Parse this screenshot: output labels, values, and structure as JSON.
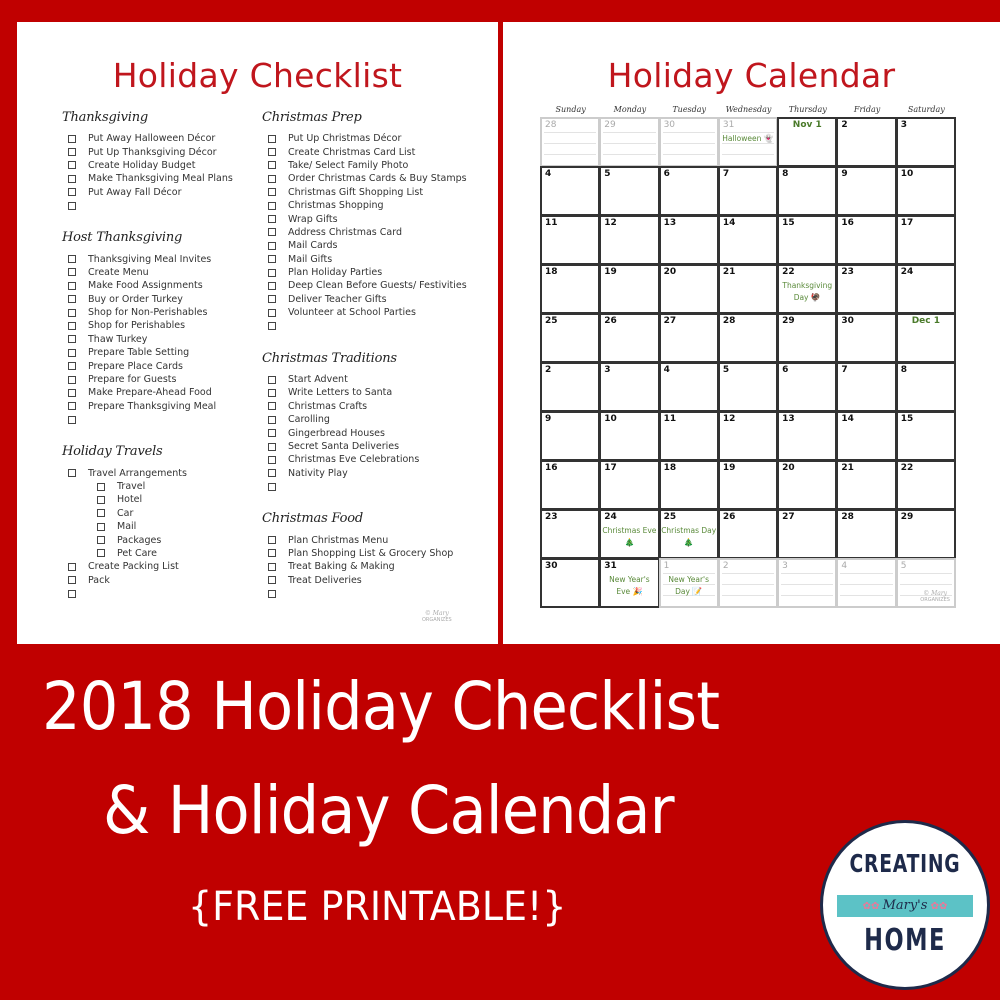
{
  "colors": {
    "background": "#c00000",
    "title_red": "#c0161d",
    "holiday_green": "#5a8a3a",
    "logo_navy": "#1e2a4a",
    "logo_teal": "#5cc2c6"
  },
  "checklist": {
    "title": "Holiday Checklist",
    "column1": [
      {
        "title": "Thanksgiving",
        "items": [
          {
            "label": "Put Away Halloween Décor"
          },
          {
            "label": "Put Up Thanksgiving Décor"
          },
          {
            "label": "Create Holiday Budget"
          },
          {
            "label": "Make Thanksgiving Meal Plans"
          },
          {
            "label": "Put Away Fall Décor"
          },
          {
            "label": ""
          }
        ]
      },
      {
        "title": "Host Thanksgiving",
        "items": [
          {
            "label": "Thanksgiving Meal Invites"
          },
          {
            "label": "Create Menu"
          },
          {
            "label": "Make Food Assignments"
          },
          {
            "label": "Buy or Order Turkey"
          },
          {
            "label": "Shop for Non-Perishables"
          },
          {
            "label": "Shop for Perishables"
          },
          {
            "label": "Thaw Turkey"
          },
          {
            "label": "Prepare Table Setting"
          },
          {
            "label": "Prepare Place Cards"
          },
          {
            "label": "Prepare for Guests"
          },
          {
            "label": "Make Prepare-Ahead Food"
          },
          {
            "label": "Prepare Thanksgiving Meal"
          },
          {
            "label": ""
          }
        ]
      },
      {
        "title": "Holiday Travels",
        "items": [
          {
            "label": "Travel Arrangements"
          },
          {
            "label": "Travel",
            "sub": true
          },
          {
            "label": "Hotel",
            "sub": true
          },
          {
            "label": "Car",
            "sub": true
          },
          {
            "label": "Mail",
            "sub": true
          },
          {
            "label": "Packages",
            "sub": true
          },
          {
            "label": "Pet Care",
            "sub": true
          },
          {
            "label": "Create Packing List"
          },
          {
            "label": "Pack"
          },
          {
            "label": ""
          }
        ]
      }
    ],
    "column2": [
      {
        "title": "Christmas Prep",
        "items": [
          {
            "label": "Put Up Christmas Décor"
          },
          {
            "label": "Create Christmas Card List"
          },
          {
            "label": "Take/ Select Family Photo"
          },
          {
            "label": "Order Christmas Cards & Buy Stamps"
          },
          {
            "label": "Christmas Gift Shopping List"
          },
          {
            "label": "Christmas Shopping"
          },
          {
            "label": "Wrap Gifts"
          },
          {
            "label": "Address Christmas Card"
          },
          {
            "label": "Mail Cards"
          },
          {
            "label": "Mail Gifts"
          },
          {
            "label": "Plan Holiday Parties"
          },
          {
            "label": "Deep Clean Before Guests/ Festivities"
          },
          {
            "label": "Deliver Teacher Gifts"
          },
          {
            "label": "Volunteer at School Parties"
          },
          {
            "label": ""
          }
        ]
      },
      {
        "title": "Christmas Traditions",
        "items": [
          {
            "label": "Start Advent"
          },
          {
            "label": "Write Letters to Santa"
          },
          {
            "label": "Christmas Crafts"
          },
          {
            "label": "Carolling"
          },
          {
            "label": "Gingerbread Houses"
          },
          {
            "label": "Secret Santa Deliveries"
          },
          {
            "label": "Christmas Eve Celebrations"
          },
          {
            "label": "Nativity Play"
          },
          {
            "label": ""
          }
        ]
      },
      {
        "title": "Christmas Food",
        "items": [
          {
            "label": "Plan Christmas Menu"
          },
          {
            "label": "Plan Shopping List & Grocery Shop"
          },
          {
            "label": "Treat Baking & Making"
          },
          {
            "label": "Treat Deliveries"
          },
          {
            "label": ""
          }
        ]
      }
    ],
    "watermark": {
      "sig": "© Mary",
      "brand": "ORGANIZES"
    }
  },
  "calendar": {
    "title": "Holiday Calendar",
    "weekdays": [
      "Sunday",
      "Monday",
      "Tuesday",
      "Wednesday",
      "Thursday",
      "Friday",
      "Saturday"
    ],
    "weeks": [
      [
        {
          "day": "28",
          "faded": true
        },
        {
          "day": "29",
          "faded": true
        },
        {
          "day": "30",
          "faded": true
        },
        {
          "day": "31",
          "faded": true,
          "event": "Halloween",
          "icon": "👻"
        },
        {
          "day": "Nov 1",
          "month_label": true
        },
        {
          "day": "2"
        },
        {
          "day": "3"
        }
      ],
      [
        {
          "day": "4"
        },
        {
          "day": "5"
        },
        {
          "day": "6"
        },
        {
          "day": "7"
        },
        {
          "day": "8"
        },
        {
          "day": "9"
        },
        {
          "day": "10"
        }
      ],
      [
        {
          "day": "11"
        },
        {
          "day": "12"
        },
        {
          "day": "13"
        },
        {
          "day": "14"
        },
        {
          "day": "15"
        },
        {
          "day": "16"
        },
        {
          "day": "17"
        }
      ],
      [
        {
          "day": "18"
        },
        {
          "day": "19"
        },
        {
          "day": "20"
        },
        {
          "day": "21"
        },
        {
          "day": "22",
          "event": "Thanksgiving Day",
          "icon": "🦃"
        },
        {
          "day": "23"
        },
        {
          "day": "24"
        }
      ],
      [
        {
          "day": "25"
        },
        {
          "day": "26"
        },
        {
          "day": "27"
        },
        {
          "day": "28"
        },
        {
          "day": "29"
        },
        {
          "day": "30"
        },
        {
          "day": "Dec 1",
          "month_label": true
        }
      ],
      [
        {
          "day": "2"
        },
        {
          "day": "3"
        },
        {
          "day": "4"
        },
        {
          "day": "5"
        },
        {
          "day": "6"
        },
        {
          "day": "7"
        },
        {
          "day": "8"
        }
      ],
      [
        {
          "day": "9"
        },
        {
          "day": "10"
        },
        {
          "day": "11"
        },
        {
          "day": "12"
        },
        {
          "day": "13"
        },
        {
          "day": "14"
        },
        {
          "day": "15"
        }
      ],
      [
        {
          "day": "16"
        },
        {
          "day": "17"
        },
        {
          "day": "18"
        },
        {
          "day": "19"
        },
        {
          "day": "20"
        },
        {
          "day": "21"
        },
        {
          "day": "22"
        }
      ],
      [
        {
          "day": "23"
        },
        {
          "day": "24",
          "event": "Christmas Eve",
          "icon": "🎄"
        },
        {
          "day": "25",
          "event": "Christmas Day",
          "icon": "🎄"
        },
        {
          "day": "26"
        },
        {
          "day": "27"
        },
        {
          "day": "28"
        },
        {
          "day": "29"
        }
      ],
      [
        {
          "day": "30"
        },
        {
          "day": "31",
          "event": "New Year's Eve",
          "icon": "🎉"
        },
        {
          "day": "1",
          "faded": true,
          "event": "New Year's Day",
          "icon": "📝"
        },
        {
          "day": "2",
          "faded": true
        },
        {
          "day": "3",
          "faded": true
        },
        {
          "day": "4",
          "faded": true
        },
        {
          "day": "5",
          "faded": true,
          "watermark": true
        }
      ]
    ],
    "watermark": {
      "sig": "© Mary",
      "brand": "ORGANIZES"
    }
  },
  "headline": {
    "line1": "2018 Holiday Checklist",
    "line2": "& Holiday Calendar",
    "line3": "{FREE PRINTABLE!}"
  },
  "logo": {
    "top": "CREATING",
    "ribbon": "Mary's",
    "bottom": "HOME"
  }
}
